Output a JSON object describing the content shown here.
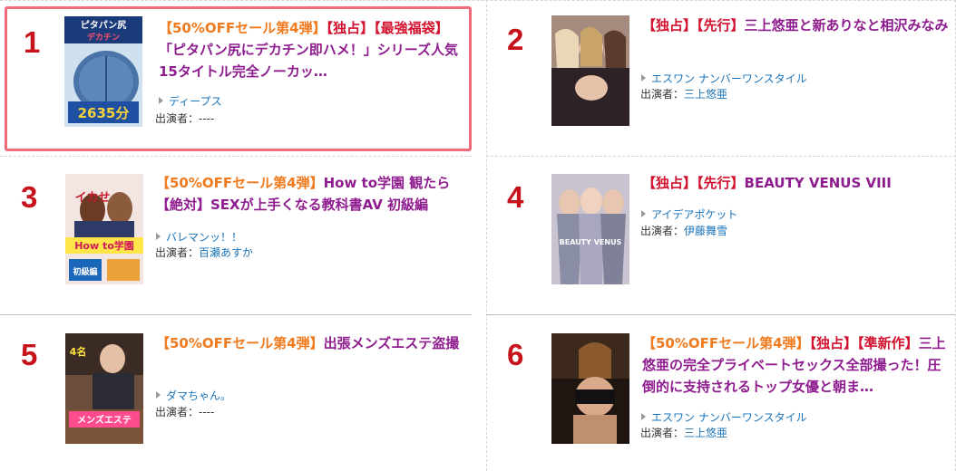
{
  "items": [
    {
      "rank": "1",
      "tags": [
        "【50%OFFセール第4弾】",
        "【独占】",
        "【最強福袋】"
      ],
      "title": "「ピタパン尻にデカチン即ハメ！」シリーズ人気15タイトル完全ノーカッ…",
      "label": "ディープス",
      "actress_prefix": "出演者：",
      "actress": "----",
      "cover_text": [
        "ピタパン尻",
        "デカチン",
        "2635分"
      ]
    },
    {
      "rank": "2",
      "tags": [
        "【独占】",
        "【先行】"
      ],
      "title": "三上悠亜と新ありなと相沢みなみ",
      "label": "エスワン ナンバーワンスタイル",
      "actress_prefix": "出演者：",
      "actress": "三上悠亜"
    },
    {
      "rank": "3",
      "tags": [
        "【50%OFFセール第4弾】"
      ],
      "title": "How to学園 観たら【絶対】SEXが上手くなる教科書AV 初級編",
      "label": "バレマンッ！！",
      "actress_prefix": "出演者：",
      "actress": "百瀬あすか",
      "cover_text": [
        "イカせ",
        "How to学園",
        "初級編"
      ]
    },
    {
      "rank": "4",
      "tags": [
        "【独占】",
        "【先行】"
      ],
      "title": "BEAUTY VENUS VIII",
      "label": "アイデアポケット",
      "actress_prefix": "出演者：",
      "actress": "伊藤舞雪",
      "cover_text": [
        "BEAUTY VENUS"
      ]
    },
    {
      "rank": "5",
      "tags": [
        "【50%OFFセール第4弾】"
      ],
      "title": "出張メンズエステ盗撮",
      "label": "ダマちゃん。",
      "actress_prefix": "出演者：",
      "actress": "----",
      "cover_text": [
        "4名",
        "メンズエステ"
      ]
    },
    {
      "rank": "6",
      "tags": [
        "【50%OFFセール第4弾】",
        "【独占】",
        "【準新作】"
      ],
      "title": "三上悠亜の完全プライベートセックス全部撮った！圧倒的に支持されるトップ女優と朝ま…",
      "label": "エスワン ナンバーワンスタイル",
      "actress_prefix": "出演者：",
      "actress": "三上悠亜"
    }
  ]
}
